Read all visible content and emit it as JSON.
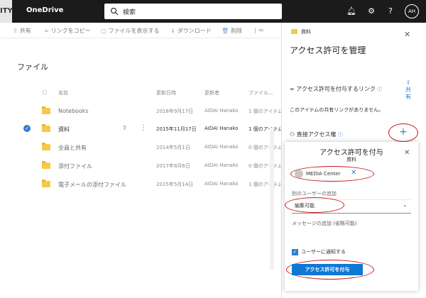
{
  "topbar": {
    "edge_text": "ITY",
    "app_name": "OneDrive",
    "search_placeholder": "検索",
    "avatar": "AH"
  },
  "cmdbar": {
    "share": "共有",
    "copy_link": "リンクをコピー",
    "show_files": "ファイルを表示する",
    "download": "ダウンロード",
    "delete": "削除",
    "more": "≔"
  },
  "page_title": "ファイル",
  "columns": {
    "name": "名前",
    "modified": "更新日時",
    "modified_by": "更新者",
    "file_size": "ファイル..."
  },
  "files": [
    {
      "name": "Notebooks",
      "date": "2018年9月17日",
      "by": "AIDAI Hanako",
      "share": "1 個のアイテム"
    },
    {
      "name": "資料",
      "date": "2015年11月17日",
      "by": "AIDAI Hanako",
      "share": "1 個のアイテム"
    },
    {
      "name": "全員と共有",
      "date": "2014年5月1日",
      "by": "AIDAI Hanako",
      "share": "0 個のアイテム"
    },
    {
      "name": "添付ファイル",
      "date": "2017年8月6日",
      "by": "AIDAI Hanako",
      "share": "0 個のアイテム"
    },
    {
      "name": "電子メールの添付ファイル",
      "date": "2015年5月14日",
      "by": "AIDAI Hanako",
      "share": "1 個のアイテム"
    }
  ],
  "pane": {
    "crumb": "資料",
    "title": "アクセス許可を管理",
    "links_section": "アクセス許可を付与するリンク",
    "share_label": "共有",
    "no_links": "このアイテムの共有リンクがありません。",
    "direct_access": "直接アクセス権",
    "plus": "+"
  },
  "grant": {
    "title": "アクセス許可を付与",
    "subtitle": "資料",
    "person": "MEDIA Center",
    "add_user_label": "別のユーザーの追加",
    "permission": "編集可能",
    "message_placeholder": "メッセージの追加 (省略可能)",
    "notify": "ユーザーに通知する",
    "grant_button": "アクセス許可を付与"
  },
  "colors": {
    "accent": "#0f78d4",
    "highlight": "#c4161c",
    "folder": "#f7c948"
  }
}
